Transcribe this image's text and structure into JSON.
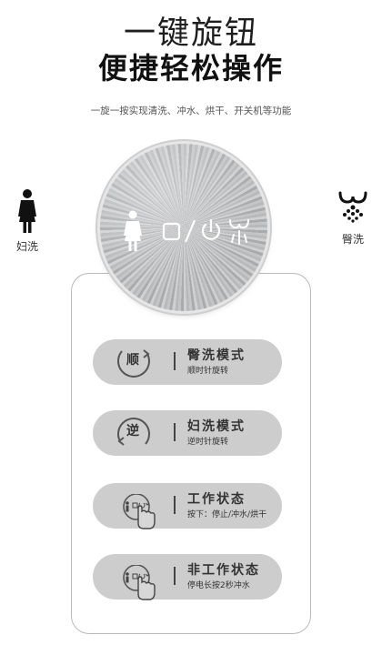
{
  "header": {
    "title_line1": "一键旋钮",
    "title_line2": "便捷轻松操作",
    "subtitle": "一旋一按实现清洗、冲水、烘干、开关机等功能"
  },
  "modes": {
    "left_label": "妇洗",
    "right_label": "臀洗"
  },
  "knob": {
    "icons": [
      "woman-icon",
      "square-icon",
      "slash",
      "power-icon",
      "rear-wash-icon"
    ]
  },
  "instructions": [
    {
      "badge": "顺",
      "name": "臀洗模式",
      "desc": "顺时针旋转"
    },
    {
      "badge": "逆",
      "name": "妇洗模式",
      "desc": "逆时针旋转"
    },
    {
      "badge": "",
      "name": "工作状态",
      "desc": "按下：停止/冲水/烘干"
    },
    {
      "badge": "",
      "name": "非工作状态",
      "desc": "停电长按2秒冲水"
    }
  ],
  "colors": {
    "pill_bg": "#cdcdcd",
    "knob_metal": "#bdbec0",
    "text_dark": "#222222"
  }
}
